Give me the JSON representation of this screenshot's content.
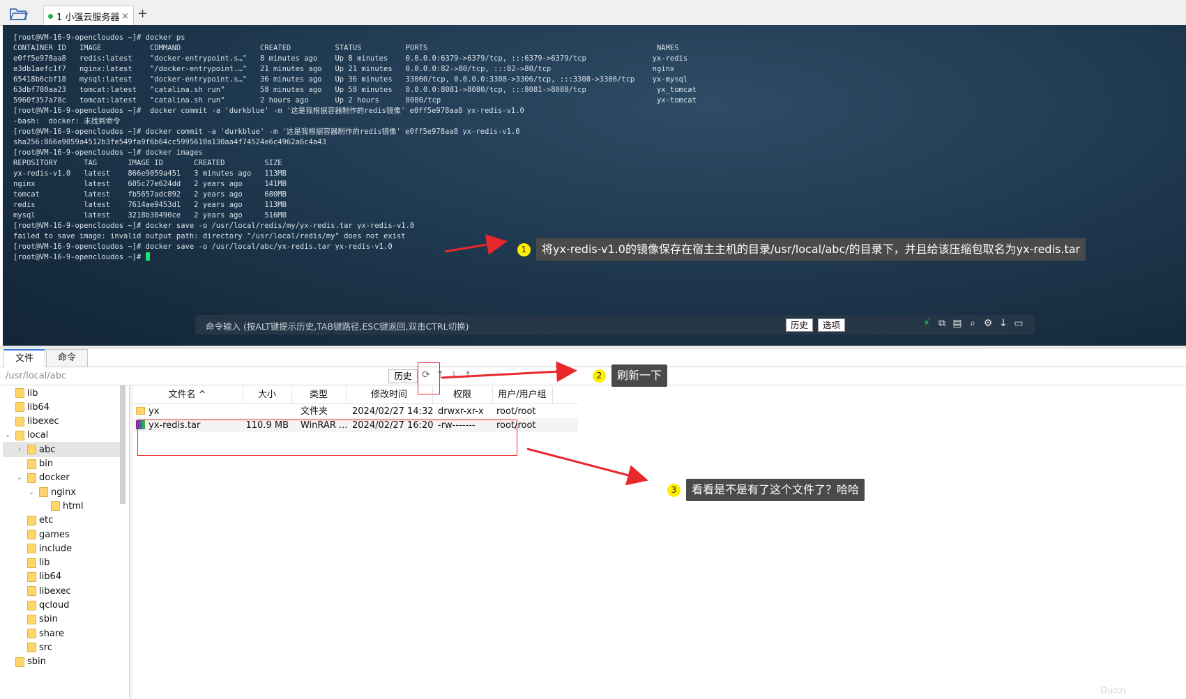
{
  "session_tab": {
    "label": "1 小强云服务器",
    "close": "×",
    "add": "+"
  },
  "terminal": {
    "lines": [
      "[root@VM-16-9-opencloudos ~]# docker ps",
      "CONTAINER ID   IMAGE           COMMAND                  CREATED          STATUS          PORTS                                                    NAMES",
      "e0ff5e978aa8   redis:latest    \"docker-entrypoint.s…\"   8 minutes ago    Up 8 minutes    0.0.0.0:6379->6379/tcp, :::6379->6379/tcp               yx-redis",
      "e3db1aefc1f7   nginx:latest    \"/docker-entrypoint.…\"   21 minutes ago   Up 21 minutes   0.0.0.0:82->80/tcp, :::82->80/tcp                       nginx",
      "65418b6cbf18   mysql:latest    \"docker-entrypoint.s…\"   36 minutes ago   Up 36 minutes   33060/tcp, 0.0.0.0:3308->3306/tcp, :::3308->3306/tcp    yx-mysql",
      "63dbf780aa23   tomcat:latest   \"catalina.sh run\"        58 minutes ago   Up 58 minutes   0.0.0.0:8081->8080/tcp, :::8081->8080/tcp                yx_tomcat",
      "5960f357a78c   tomcat:latest   \"catalina.sh run\"        2 hours ago      Up 2 hours      8080/tcp                                                 yx-tomcat",
      "[root@VM-16-9-opencloudos ~]#  docker commit -a 'durkblue' -m '这是我根据容器制作的redis镜像' e0ff5e978aa8 yx-redis-v1.0",
      "-bash:  docker: 未找到命令",
      "[root@VM-16-9-opencloudos ~]# docker commit -a 'durkblue' -m '这是我根据容器制作的redis镜像' e0ff5e978aa8 yx-redis-v1.0",
      "sha256:866e9059a4512b3fe549fa9f6b64cc5995610a130aa4f74524e6c4962a6c4a43",
      "[root@VM-16-9-opencloudos ~]# docker images",
      "REPOSITORY      TAG       IMAGE ID       CREATED         SIZE",
      "yx-redis-v1.0   latest    866e9059a451   3 minutes ago   113MB",
      "nginx           latest    605c77e624dd   2 years ago     141MB",
      "tomcat          latest    fb5657adc892   2 years ago     680MB",
      "redis           latest    7614ae9453d1   2 years ago     113MB",
      "mysql           latest    3218b38490ce   2 years ago     516MB",
      "[root@VM-16-9-opencloudos ~]# docker save -o /usr/local/redis/my/yx-redis.tar yx-redis-v1.0",
      "failed to save image: invalid output path: directory \"/usr/local/redis/my\" does not exist",
      "[root@VM-16-9-opencloudos ~]# docker save -o /usr/local/abc/yx-redis.tar yx-redis-v1.0"
    ],
    "prompt": "[root@VM-16-9-opencloudos ~]# "
  },
  "command_bar": {
    "placeholder": "命令输入 (按ALT键提示历史,TAB键路径,ESC键返回,双击CTRL切换)",
    "history_label": "历史",
    "options_label": "选项"
  },
  "panel_tabs": {
    "files": "文件",
    "commands": "命令"
  },
  "path_bar": {
    "path": "/usr/local/abc",
    "history_label": "历史"
  },
  "tree": [
    {
      "name": "lib",
      "level": 1,
      "caret": ""
    },
    {
      "name": "lib64",
      "level": 1,
      "caret": ""
    },
    {
      "name": "libexec",
      "level": 1,
      "caret": ""
    },
    {
      "name": "local",
      "level": 1,
      "caret": "expanded"
    },
    {
      "name": "abc",
      "level": 2,
      "caret": "collapsed",
      "selected": true
    },
    {
      "name": "bin",
      "level": 2,
      "caret": ""
    },
    {
      "name": "docker",
      "level": 2,
      "caret": "expanded"
    },
    {
      "name": "nginx",
      "level": 3,
      "caret": "expanded"
    },
    {
      "name": "html",
      "level": 4,
      "caret": ""
    },
    {
      "name": "etc",
      "level": 2,
      "caret": ""
    },
    {
      "name": "games",
      "level": 2,
      "caret": ""
    },
    {
      "name": "include",
      "level": 2,
      "caret": ""
    },
    {
      "name": "lib",
      "level": 2,
      "caret": ""
    },
    {
      "name": "lib64",
      "level": 2,
      "caret": ""
    },
    {
      "name": "libexec",
      "level": 2,
      "caret": ""
    },
    {
      "name": "qcloud",
      "level": 2,
      "caret": ""
    },
    {
      "name": "sbin",
      "level": 2,
      "caret": ""
    },
    {
      "name": "share",
      "level": 2,
      "caret": ""
    },
    {
      "name": "src",
      "level": 2,
      "caret": ""
    },
    {
      "name": "sbin",
      "level": 1,
      "caret": ""
    }
  ],
  "file_table": {
    "columns": [
      "文件名 ^",
      "大小",
      "类型",
      "修改时间",
      "权限",
      "用户/用户组"
    ],
    "rows": [
      {
        "name": "yx",
        "size": "",
        "type": "文件夹",
        "modified": "2024/02/27 14:32",
        "perms": "drwxr-xr-x",
        "owner": "root/root",
        "icon": "folder-icon"
      },
      {
        "name": "yx-redis.tar",
        "size": "110.9 MB",
        "type": "WinRAR ...",
        "modified": "2024/02/27 16:20",
        "perms": "-rw-------",
        "owner": "root/root",
        "icon": "rar-archive-icon"
      }
    ]
  },
  "annotations": [
    {
      "num": "1",
      "text": "将yx-redis-v1.0的镜像保存在宿主主机的目录/usr/local/abc/的目录下，并且给该压缩包取名为yx-redis.tar"
    },
    {
      "num": "2",
      "text": "刷新一下"
    },
    {
      "num": "3",
      "text": "看看是不是有了这个文件了？哈哈"
    }
  ],
  "watermark": "Duozi",
  "colors": {
    "accent_red": "#e8282c",
    "callout_bg": "#4a4a4a",
    "badge_yellow": "#ffee00",
    "cursor_green": "#1ee06c"
  }
}
